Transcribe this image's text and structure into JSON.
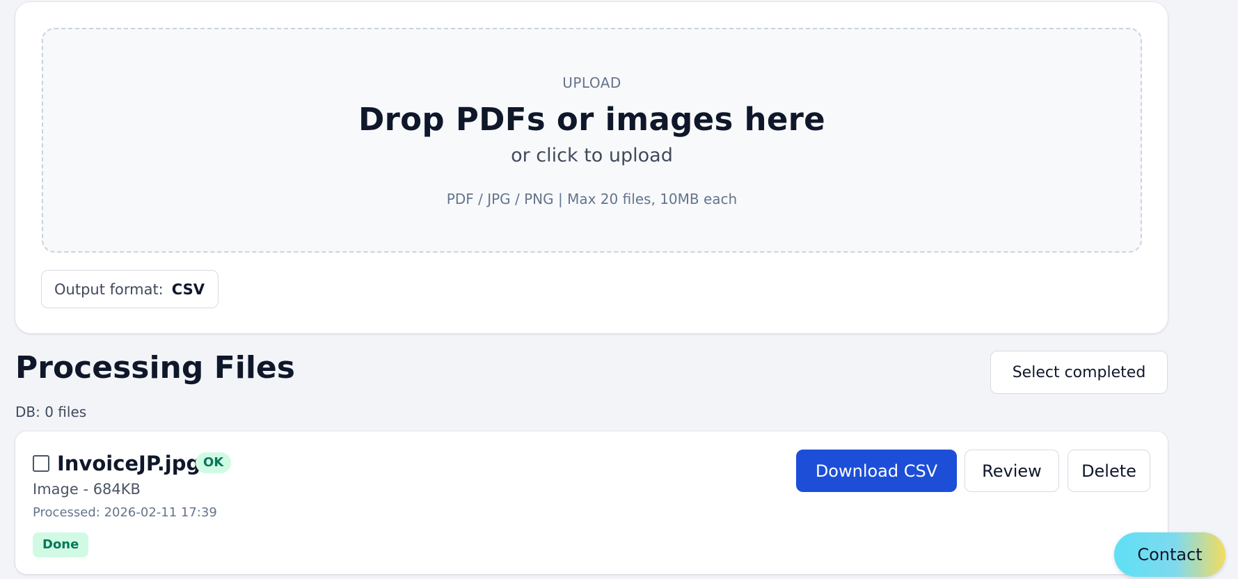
{
  "upload": {
    "eyebrow": "UPLOAD",
    "title": "Drop PDFs or images here",
    "subtitle": "or click to upload",
    "hint": "PDF / JPG / PNG | Max 20 files, 10MB each",
    "output_format_label": "Output format:",
    "output_format_value": "CSV"
  },
  "processing": {
    "title": "Processing Files",
    "db_count": "DB: 0 files",
    "select_completed_label": "Select completed"
  },
  "files": [
    {
      "checked": false,
      "name": "InvoiceJP.jpg",
      "badge": "OK",
      "meta": "Image - 684KB",
      "processed": "Processed: 2026-02-11 17:39",
      "status": "Done",
      "actions": {
        "download": "Download CSV",
        "review": "Review",
        "delete": "Delete"
      }
    }
  ],
  "contact_label": "Contact",
  "colors": {
    "accent": "#1d4ed8",
    "success_bg": "#d1fae5",
    "success_text": "#047857",
    "page_bg": "#f2f4f8"
  }
}
